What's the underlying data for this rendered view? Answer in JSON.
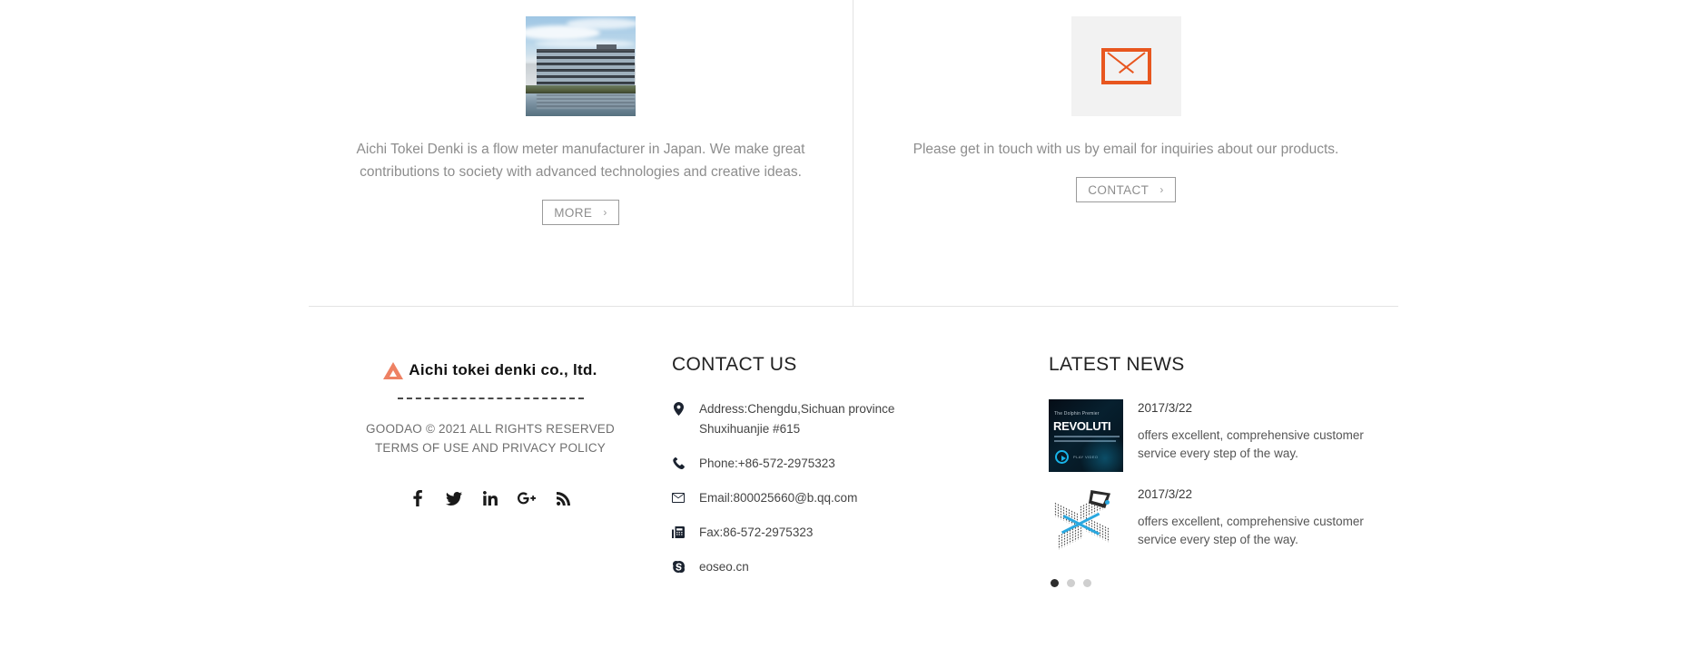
{
  "top": {
    "left_panel": {
      "image_alt": "aichi-tokei-denki-headquarters-building",
      "description": "Aichi Tokei Denki is a flow meter manufacturer in Japan. We make great contributions to society with advanced technologies and creative ideas.",
      "button_label": "MORE",
      "button_chevron": "›"
    },
    "right_panel": {
      "icon": "envelope-icon",
      "icon_color": "#E8561F",
      "description": "Please get in touch with us by email for inquiries about our products.",
      "button_label": "CONTACT",
      "button_chevron": "›"
    }
  },
  "footer": {
    "brand": {
      "logo_mark": "triangle-logo-icon",
      "logo_text": "Aichi tokei denki co., ltd.",
      "copyright_line1": "GOODAO © 2021 ALL RIGHTS RESERVED",
      "copyright_line2": "TERMS OF USE AND PRIVACY POLICY",
      "social": [
        {
          "name": "facebook-icon",
          "label": "Facebook"
        },
        {
          "name": "twitter-icon",
          "label": "Twitter"
        },
        {
          "name": "linkedin-icon",
          "label": "LinkedIn"
        },
        {
          "name": "googleplus-icon",
          "label": "Google Plus"
        },
        {
          "name": "rss-icon",
          "label": "RSS"
        }
      ]
    },
    "contact": {
      "title": "CONTACT US",
      "items": [
        {
          "icon": "map-pin-icon",
          "text": "Address:Chengdu,Sichuan province\nShuxihuanjie #615"
        },
        {
          "icon": "phone-icon",
          "text": "Phone:+86-572-2975323"
        },
        {
          "icon": "email-icon",
          "text": "Email:800025660@b.qq.com"
        },
        {
          "icon": "fax-icon",
          "text": "Fax:86-572-2975323"
        },
        {
          "icon": "skype-icon",
          "text": "eoseo.cn"
        }
      ]
    },
    "news": {
      "title": "LATEST NEWS",
      "items": [
        {
          "thumb": "dolphin-premier-revolution-video-thumbnail",
          "thumb_line1": "The Dolphin Premier",
          "thumb_line2": "REVOLUTI",
          "thumb_play_label": "PLAY VIDEO",
          "date": "2017/3/22",
          "description": "offers excellent, comprehensive customer service every step of the way."
        },
        {
          "thumb": "isometric-network-illustration-thumbnail",
          "date": "2017/3/22",
          "description": "offers excellent, comprehensive customer service every step of the way."
        }
      ],
      "carousel_dots": 3,
      "active_dot": 0
    }
  }
}
